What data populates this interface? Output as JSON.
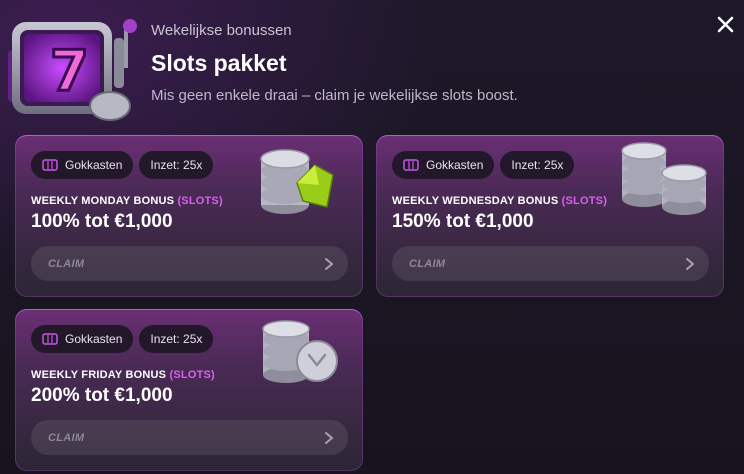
{
  "header": {
    "eyebrow": "Wekelijkse bonussen",
    "title": "Slots pakket",
    "subtitle": "Mis geen enkele draai – claim je wekelijkse slots boost."
  },
  "icons": {
    "hero": "slot-machine-icon",
    "close": "close-icon",
    "chip": "slot-reels-icon",
    "arrow": "chevron-right-icon"
  },
  "colors": {
    "accent": "#d860ef",
    "background": "#181522",
    "chip_bg": "#23182a"
  },
  "cards": [
    {
      "category": "Gokkasten",
      "wager": "Inzet: 25x",
      "name": "WEEKLY MONDAY BONUS",
      "tag": "(SLOTS)",
      "amount": "100% tot €1,000",
      "claim": "CLAIM",
      "art": "coins-with-gem-icon"
    },
    {
      "category": "Gokkasten",
      "wager": "Inzet: 25x",
      "name": "WEEKLY WEDNESDAY BONUS",
      "tag": "(SLOTS)",
      "amount": "150% tot €1,000",
      "claim": "CLAIM",
      "art": "coin-stacks-icon"
    },
    {
      "category": "Gokkasten",
      "wager": "Inzet: 25x",
      "name": "WEEKLY FRIDAY BONUS",
      "tag": "(SLOTS)",
      "amount": "200% tot €1,000",
      "claim": "CLAIM",
      "art": "coin-stack-icon"
    }
  ]
}
